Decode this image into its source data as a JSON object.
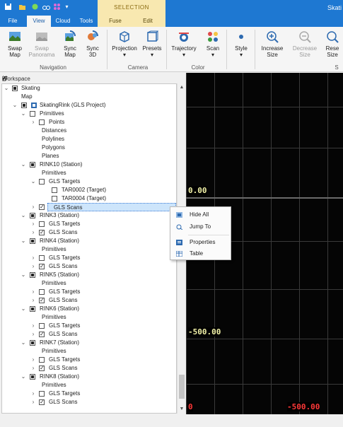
{
  "app": {
    "title": "Skati"
  },
  "contextual": {
    "group": "SELECTION",
    "tabs": [
      "Fuse",
      "Edit"
    ]
  },
  "tabs": [
    "File",
    "View",
    "Cloud",
    "Tools"
  ],
  "ribbon": {
    "navigation": {
      "label": "Navigation",
      "buttons": [
        {
          "label1": "Swap",
          "label2": "Map"
        },
        {
          "label1": "Swap",
          "label2": "Panorama"
        },
        {
          "label1": "Sync",
          "label2": "Map"
        },
        {
          "label1": "Sync",
          "label2": "3D"
        }
      ]
    },
    "camera": {
      "label": "Camera",
      "buttons": [
        {
          "label": "Projection"
        },
        {
          "label": "Presets"
        }
      ]
    },
    "color": {
      "label": "Color",
      "buttons": [
        {
          "label": "Trajectory"
        },
        {
          "label": "Scan"
        }
      ]
    },
    "style": {
      "label": "Style"
    },
    "size": {
      "buttons": [
        {
          "label1": "Increase",
          "label2": "Size"
        },
        {
          "label1": "Decrease",
          "label2": "Size"
        },
        {
          "label1": "Rese",
          "label2": "Size"
        }
      ],
      "group_label": "S"
    }
  },
  "workspace": {
    "title": "Workspace"
  },
  "tree": [
    {
      "label": "Skating"
    },
    {
      "label": "Map"
    },
    {
      "label": "SkatingRink (GLS Project)"
    },
    {
      "label": "Primitives"
    },
    {
      "label": "Points"
    },
    {
      "label": "Distances"
    },
    {
      "label": "Polylines"
    },
    {
      "label": "Polygons"
    },
    {
      "label": "Planes"
    },
    {
      "label": "RINK10 (Station)"
    },
    {
      "label": "Primitives"
    },
    {
      "label": "GLS Targets"
    },
    {
      "label": "TAR0002 (Target)"
    },
    {
      "label": "TAR0004 (Target)"
    },
    {
      "label": "GLS Scans"
    },
    {
      "label": "RINK3 (Station)"
    },
    {
      "label": "GLS Targets"
    },
    {
      "label": "GLS Scans"
    },
    {
      "label": "RINK4 (Station)"
    },
    {
      "label": "Primitives"
    },
    {
      "label": "GLS Targets"
    },
    {
      "label": "GLS Scans"
    },
    {
      "label": "RINK5 (Station)"
    },
    {
      "label": "Primitives"
    },
    {
      "label": "GLS Targets"
    },
    {
      "label": "GLS Scans"
    },
    {
      "label": "RINK6 (Station)"
    },
    {
      "label": "Primitives"
    },
    {
      "label": "GLS Targets"
    },
    {
      "label": "GLS Scans"
    },
    {
      "label": "RINK7 (Station)"
    },
    {
      "label": "Primitives"
    },
    {
      "label": "GLS Targets"
    },
    {
      "label": "GLS Scans"
    },
    {
      "label": "RINK8 (Station)"
    },
    {
      "label": "Primitives"
    },
    {
      "label": "GLS Targets"
    },
    {
      "label": "GLS Scans"
    }
  ],
  "context_menu": [
    "Hide All",
    "Jump To",
    "Properties",
    "Table"
  ],
  "viewport": {
    "labels": [
      "0.00",
      "-500.00",
      "0",
      "-500.00"
    ]
  }
}
